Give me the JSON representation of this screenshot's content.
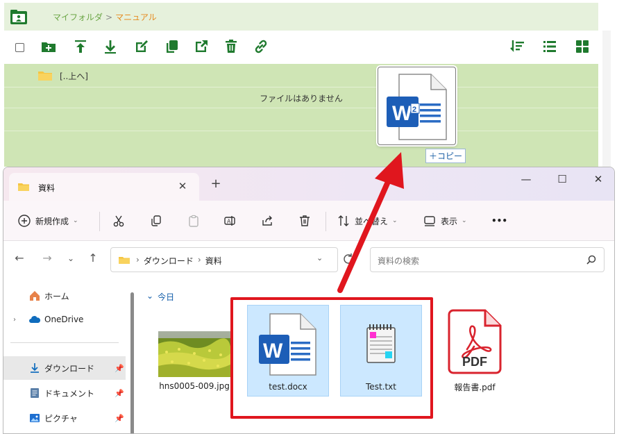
{
  "webapp": {
    "breadcrumb": [
      "マイフォルダ",
      ">",
      "マニュアル"
    ],
    "parent_label": "[..上へ]",
    "empty_message": "ファイルはありません",
    "drag_badge": "＋コピー",
    "colors": {
      "header_bg": "#e6f1dc",
      "list_bg": "#cfe5b5",
      "icon_green": "#1f7a2e",
      "accent_orange": "#e58a1f"
    },
    "toolbar_icons": [
      "new-folder-icon",
      "upload-icon",
      "download-icon",
      "edit-icon",
      "copy-icon",
      "move-icon",
      "delete-icon",
      "link-icon",
      "sort-icon",
      "list-view-icon",
      "grid-view-icon"
    ]
  },
  "explorer": {
    "tab_title": "資料",
    "tab_close": "✕",
    "new_tab": "+",
    "window_buttons": {
      "minimize": "—",
      "maximize": "☐",
      "close": "✕"
    },
    "cmdbar": {
      "new_label": "新規作成",
      "sort_label": "並べ替え",
      "view_label": "表示",
      "more": "•••"
    },
    "address": {
      "path": [
        "ダウンロード",
        "資料"
      ],
      "separator": "›"
    },
    "search_placeholder": "資料の検索",
    "nav_items": [
      {
        "label": "ホーム",
        "icon": "home-icon"
      },
      {
        "label": "OneDrive",
        "icon": "cloud-icon"
      },
      {
        "label": "ダウンロード",
        "icon": "download-folder-icon"
      },
      {
        "label": "ドキュメント",
        "icon": "documents-icon"
      },
      {
        "label": "ピクチャ",
        "icon": "pictures-icon"
      }
    ],
    "group_header": "今日",
    "files": [
      {
        "name": "hns0005-009.jpg",
        "type": "image"
      },
      {
        "name": "test.docx",
        "type": "word"
      },
      {
        "name": "Test.txt",
        "type": "text"
      },
      {
        "name": "報告書.pdf",
        "type": "pdf"
      }
    ],
    "colors": {
      "accent_blue": "#0e5aa8",
      "selection": "#cce8ff",
      "highlight_red": "#e0161e"
    }
  }
}
